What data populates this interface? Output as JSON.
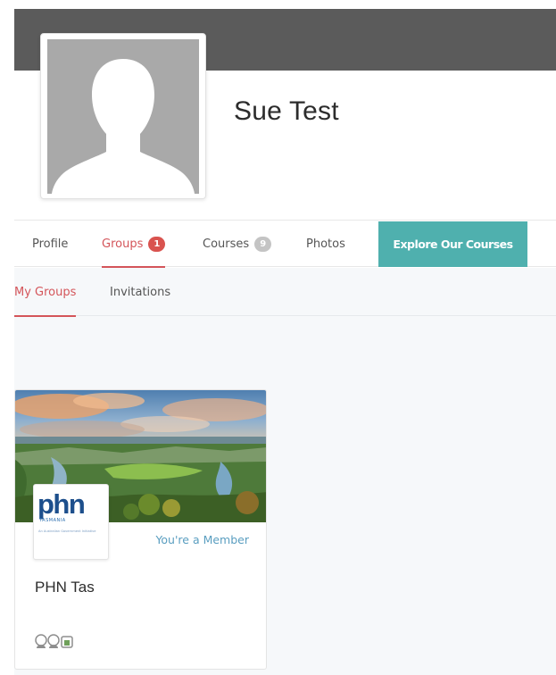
{
  "profile": {
    "name": "Sue Test",
    "cover_color": "#5b5b5b",
    "avatar_icon": "default-avatar-icon"
  },
  "tabs": [
    {
      "label": "Profile"
    },
    {
      "label": "Groups",
      "count": "1"
    },
    {
      "label": "Courses",
      "count": "9"
    },
    {
      "label": "Photos"
    }
  ],
  "explore_button": {
    "label": "Explore Our Courses",
    "color": "#4fb0ae"
  },
  "subtabs": [
    {
      "label": "My Groups"
    },
    {
      "label": "Invitations"
    }
  ],
  "group": {
    "logo_text": "phn",
    "logo_subtext": "TASMANIA",
    "logo_tagline": "An Australian Government Initiative",
    "status": "You're a Member",
    "name": "PHN Tas",
    "member_icons": [
      "member-avatar-icon",
      "member-avatar-icon",
      "member-avatar-icon"
    ]
  },
  "colors": {
    "accent": "#d4555a",
    "badge_red": "#d9534f",
    "badge_grey": "#c4c4c4",
    "member_status": "#5a9ec0"
  }
}
